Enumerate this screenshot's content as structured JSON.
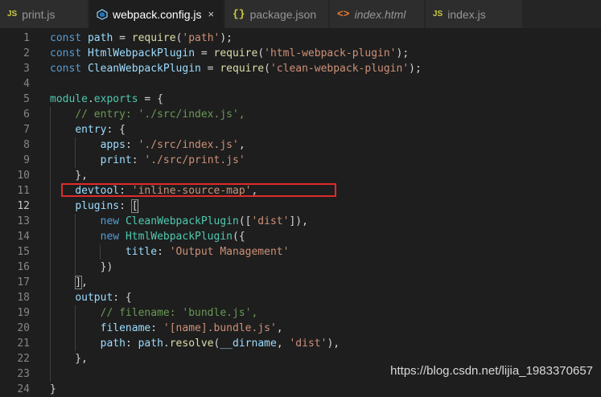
{
  "tabs": [
    {
      "label": "print.js",
      "icon": "js-icon",
      "icon_text": "JS",
      "active": false,
      "italic": false
    },
    {
      "label": "webpack.config.js",
      "icon": "webpack-icon",
      "active": true,
      "italic": false,
      "close": "×"
    },
    {
      "label": "package.json",
      "icon": "json-icon",
      "icon_text": "{}",
      "active": false,
      "italic": false
    },
    {
      "label": "index.html",
      "icon": "html-icon",
      "icon_text": "<>",
      "active": false,
      "italic": true
    },
    {
      "label": "index.js",
      "icon": "js-icon",
      "icon_text": "JS",
      "active": false,
      "italic": false
    }
  ],
  "editor": {
    "current_line": 12,
    "highlighted_line": 11,
    "lines": [
      {
        "n": "1",
        "tokens": [
          [
            "k",
            "const "
          ],
          [
            "v",
            "path"
          ],
          [
            "p",
            " = "
          ],
          [
            "f",
            "require"
          ],
          [
            "p",
            "("
          ],
          [
            "s",
            "'path'"
          ],
          [
            "p",
            ");"
          ]
        ]
      },
      {
        "n": "2",
        "tokens": [
          [
            "k",
            "const "
          ],
          [
            "v",
            "HtmlWebpackPlugin"
          ],
          [
            "p",
            " = "
          ],
          [
            "f",
            "require"
          ],
          [
            "p",
            "("
          ],
          [
            "s",
            "'html-webpack-plugin'"
          ],
          [
            "p",
            ");"
          ]
        ]
      },
      {
        "n": "3",
        "tokens": [
          [
            "k",
            "const "
          ],
          [
            "v",
            "CleanWebpackPlugin"
          ],
          [
            "p",
            " = "
          ],
          [
            "f",
            "require"
          ],
          [
            "p",
            "("
          ],
          [
            "s",
            "'clean-webpack-plugin'"
          ],
          [
            "p",
            ");"
          ]
        ]
      },
      {
        "n": "4",
        "tokens": []
      },
      {
        "n": "5",
        "tokens": [
          [
            "t",
            "module"
          ],
          [
            "p",
            "."
          ],
          [
            "t",
            "exports"
          ],
          [
            "p",
            " = {"
          ]
        ]
      },
      {
        "n": "6",
        "tokens": [
          [
            "p",
            "    "
          ],
          [
            "c",
            "// entry: './src/index.js',"
          ]
        ]
      },
      {
        "n": "7",
        "tokens": [
          [
            "p",
            "    "
          ],
          [
            "v",
            "entry"
          ],
          [
            "p",
            ": {"
          ]
        ]
      },
      {
        "n": "8",
        "tokens": [
          [
            "p",
            "        "
          ],
          [
            "v",
            "apps"
          ],
          [
            "p",
            ": "
          ],
          [
            "s",
            "'./src/index.js'"
          ],
          [
            "p",
            ","
          ]
        ]
      },
      {
        "n": "9",
        "tokens": [
          [
            "p",
            "        "
          ],
          [
            "v",
            "print"
          ],
          [
            "p",
            ": "
          ],
          [
            "s",
            "'./src/print.js'"
          ]
        ]
      },
      {
        "n": "10",
        "tokens": [
          [
            "p",
            "    },"
          ]
        ]
      },
      {
        "n": "11",
        "tokens": [
          [
            "p",
            "    "
          ],
          [
            "v",
            "devtool"
          ],
          [
            "p",
            ": "
          ],
          [
            "s",
            "'inline-source-map'"
          ],
          [
            "p",
            ","
          ]
        ]
      },
      {
        "n": "12",
        "tokens": [
          [
            "p",
            "    "
          ],
          [
            "v",
            "plugins"
          ],
          [
            "p",
            ": ["
          ]
        ]
      },
      {
        "n": "13",
        "tokens": [
          [
            "p",
            "        "
          ],
          [
            "k",
            "new "
          ],
          [
            "t",
            "CleanWebpackPlugin"
          ],
          [
            "p",
            "(["
          ],
          [
            "s",
            "'dist'"
          ],
          [
            "p",
            "]),"
          ]
        ]
      },
      {
        "n": "14",
        "tokens": [
          [
            "p",
            "        "
          ],
          [
            "k",
            "new "
          ],
          [
            "t",
            "HtmlWebpackPlugin"
          ],
          [
            "p",
            "({"
          ]
        ]
      },
      {
        "n": "15",
        "tokens": [
          [
            "p",
            "            "
          ],
          [
            "v",
            "title"
          ],
          [
            "p",
            ": "
          ],
          [
            "s",
            "'Output Management'"
          ]
        ]
      },
      {
        "n": "16",
        "tokens": [
          [
            "p",
            "        })"
          ]
        ]
      },
      {
        "n": "17",
        "tokens": [
          [
            "p",
            "    ],"
          ]
        ]
      },
      {
        "n": "18",
        "tokens": [
          [
            "p",
            "    "
          ],
          [
            "v",
            "output"
          ],
          [
            "p",
            ": {"
          ]
        ]
      },
      {
        "n": "19",
        "tokens": [
          [
            "p",
            "        "
          ],
          [
            "c",
            "// filename: 'bundle.js',"
          ]
        ]
      },
      {
        "n": "20",
        "tokens": [
          [
            "p",
            "        "
          ],
          [
            "v",
            "filename"
          ],
          [
            "p",
            ": "
          ],
          [
            "s",
            "'[name].bundle.js'"
          ],
          [
            "p",
            ","
          ]
        ]
      },
      {
        "n": "21",
        "tokens": [
          [
            "p",
            "        "
          ],
          [
            "v",
            "path"
          ],
          [
            "p",
            ": "
          ],
          [
            "v",
            "path"
          ],
          [
            "p",
            "."
          ],
          [
            "f",
            "resolve"
          ],
          [
            "p",
            "("
          ],
          [
            "v",
            "__dirname"
          ],
          [
            "p",
            ", "
          ],
          [
            "s",
            "'dist'"
          ],
          [
            "p",
            "),"
          ]
        ]
      },
      {
        "n": "22",
        "tokens": [
          [
            "p",
            "    },"
          ]
        ]
      },
      {
        "n": "23",
        "tokens": []
      },
      {
        "n": "24",
        "tokens": [
          [
            "p",
            "}"
          ]
        ]
      }
    ]
  },
  "watermark": "https://blog.csdn.net/lijia_1983370657",
  "colors": {
    "background": "#1e1e1e",
    "keyword": "#569cd6",
    "variable": "#9cdcfe",
    "function": "#dcdcaa",
    "string": "#ce9178",
    "comment": "#6a9955",
    "type": "#4ec9b0",
    "highlight_box": "#e02b2b"
  }
}
